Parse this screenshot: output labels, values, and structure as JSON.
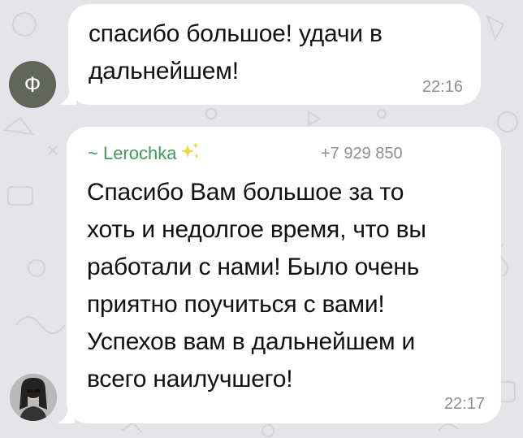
{
  "chat": {
    "messages": [
      {
        "avatar_letter": "Ф",
        "text": "спасибо большое! удачи в\nдальнейшем!",
        "time": "22:16"
      },
      {
        "sender_name": "~ Lerochka",
        "sender_phone": "+7 929 850",
        "text": "Спасибо Вам большое за то\nхоть и недолгое время, что вы\nработали с нами! Было очень\nприятно поучиться с вами!\nУспехов вам в дальнейшем и\nвсего наилучшего!",
        "time": "22:17"
      }
    ]
  },
  "colors": {
    "sender_name": "#3f9a5b",
    "bubble": "#ffffff",
    "background": "#e5e5e9",
    "avatar_letter_bg": "#62665a"
  },
  "icons": {
    "sparkle": "sparkles-icon",
    "avatar_photo": "user-photo-avatar"
  }
}
